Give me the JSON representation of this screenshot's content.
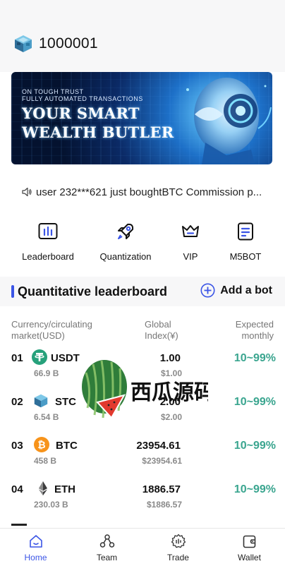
{
  "header": {
    "user_id": "1000001"
  },
  "banner": {
    "line1": "ON TOUGH TRUST",
    "line2": "FULLY AUTOMATED TRANSACTIONS",
    "headline1": "YOUR SMART",
    "headline2": "WEALTH BUTLER"
  },
  "notice": {
    "text": "user 232***621 just boughtBTC Commission p..."
  },
  "quick_actions": [
    {
      "label": "Leaderboard",
      "icon": "chart-icon"
    },
    {
      "label": "Quantization",
      "icon": "rocket-icon"
    },
    {
      "label": "VIP",
      "icon": "crown-icon"
    },
    {
      "label": "M5BOT",
      "icon": "document-icon"
    }
  ],
  "leaderboard": {
    "title": "Quantitative leaderboard",
    "add_label": "Add a bot",
    "columns": {
      "currency_line1": "Currency/circulating",
      "currency_line2": "market(USD)",
      "index_line1": "Global",
      "index_line2": "Index(¥)",
      "expected_line1": "Expected",
      "expected_line2": "monthly"
    },
    "rows": [
      {
        "rank": "01",
        "symbol": "USDT",
        "mcap": "66.9 B",
        "index": "1.00",
        "index_usd": "$1.00",
        "return": "10~99%",
        "icon_color": "#26a17b"
      },
      {
        "rank": "02",
        "symbol": "STC",
        "mcap": "6.54 B",
        "index": "2.00",
        "index_usd": "$2.00",
        "return": "10~99%",
        "icon_color": "#3a8fd0"
      },
      {
        "rank": "03",
        "symbol": "BTC",
        "mcap": "458 B",
        "index": "23954.61",
        "index_usd": "$23954.61",
        "return": "10~99%",
        "icon_color": "#f7931a"
      },
      {
        "rank": "04",
        "symbol": "ETH",
        "mcap": "230.03 B",
        "index": "1886.57",
        "index_usd": "$1886.57",
        "return": "10~99%",
        "icon_color": "#454a75"
      }
    ]
  },
  "watermark": {
    "text": "西瓜源码"
  },
  "tabs": [
    {
      "label": "Home",
      "icon": "home-icon",
      "active": true
    },
    {
      "label": "Team",
      "icon": "team-icon",
      "active": false
    },
    {
      "label": "Trade",
      "icon": "trade-icon",
      "active": false
    },
    {
      "label": "Wallet",
      "icon": "wallet-icon",
      "active": false
    }
  ],
  "colors": {
    "accent": "#3b55e6",
    "return_green": "#3aa58f"
  }
}
